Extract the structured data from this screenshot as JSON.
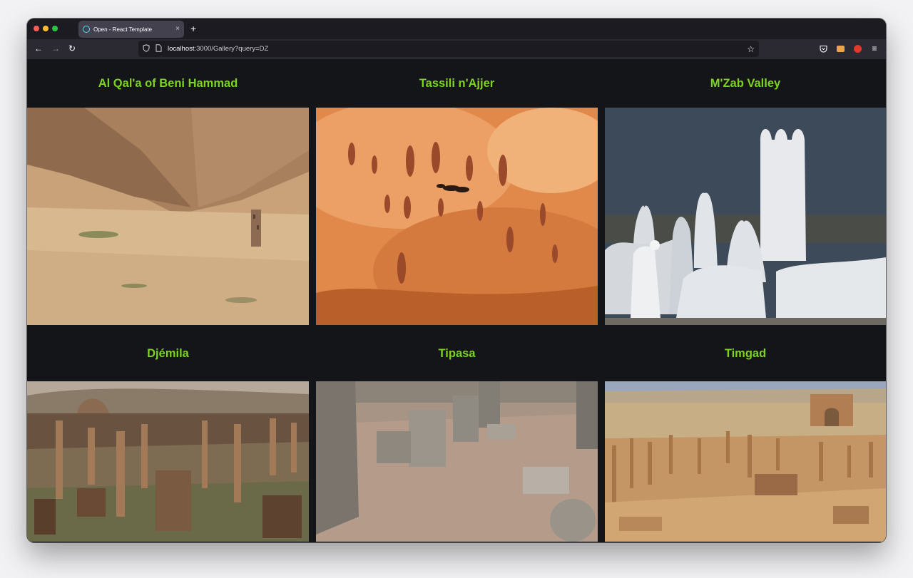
{
  "browser": {
    "tab_title": "Open - React Template",
    "tab_close": "×",
    "new_tab": "+",
    "url_host": "localhost",
    "url_rest": ":3000/Gallery?query=DZ"
  },
  "gallery": {
    "items": [
      {
        "title": "Al Qal'a of Beni Hammad"
      },
      {
        "title": "Tassili n'Ajjer"
      },
      {
        "title": "M'Zab Valley"
      },
      {
        "title": "Djémila"
      },
      {
        "title": "Tipasa"
      },
      {
        "title": "Timgad"
      }
    ]
  },
  "colors": {
    "title_green": "#7ed321",
    "page_bg": "#141518"
  }
}
